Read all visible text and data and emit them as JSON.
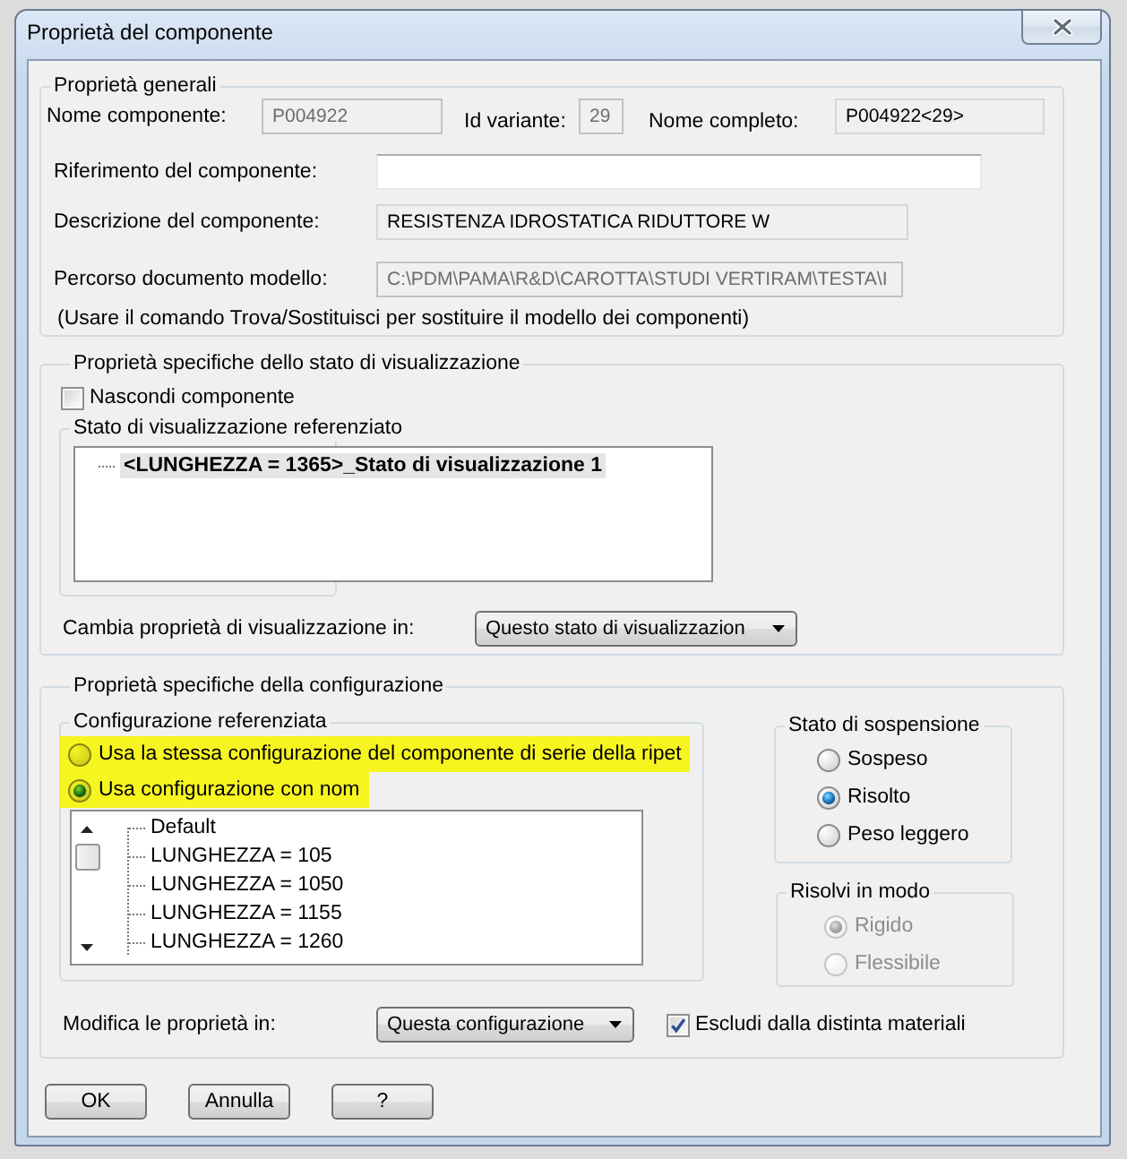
{
  "window": {
    "title": "Proprietà del componente"
  },
  "general": {
    "title": "Proprietà generali",
    "id_fields": [
      {
        "label": "Nome componente:",
        "value": "P004922",
        "disabled": true,
        "readonly": false
      },
      {
        "label": "Id variante:",
        "value": "29",
        "disabled": true,
        "readonly": false
      },
      {
        "label": "Nome completo:",
        "value": "P004922<29>",
        "disabled": false,
        "readonly": true
      }
    ],
    "fields": [
      {
        "label": "Riferimento del componente:",
        "disabled": false,
        "readonly": false
      },
      {
        "label": "Descrizione del componente:",
        "value": "RESISTENZA IDROSTATICA RIDUTTORE W",
        "disabled": false,
        "readonly": true
      },
      {
        "label": "Percorso documento modello:",
        "value": "C:\\PDM\\PAMA\\R&D\\CAROTTA\\STUDI VERTIRAM\\TESTA\\I",
        "disabled": true,
        "readonly": false
      }
    ],
    "note": "(Usare il comando Trova/Sostituisci per sostituire il modello dei componenti)"
  },
  "display_state": {
    "title": "Proprietà specifiche dello stato di visualizzazione",
    "hide_component": {
      "label": "Nascondi componente",
      "checked": false
    },
    "referenced": {
      "title": "Stato di visualizzazione referenziato",
      "items": [
        {
          "label": "<LUNGHEZZA = 1365>_Stato di visualizzazione 1",
          "selected": true
        }
      ]
    },
    "change_in": {
      "label": "Cambia proprietà di visualizzazione in:",
      "value": "Questo stato di visualizzazion"
    }
  },
  "configuration": {
    "title": "Proprietà specifiche della configurazione",
    "referenced": {
      "title": "Configurazione referenziata",
      "options": [
        {
          "label": "Usa la stessa configurazione del componente di serie della ripet",
          "selected": false,
          "highlighted": true
        },
        {
          "label": "Usa configurazione con nom",
          "selected": true,
          "highlighted": true
        }
      ],
      "configurations": [
        {
          "label": "Default",
          "selected": false
        },
        {
          "label": "LUNGHEZZA = 105",
          "selected": false
        },
        {
          "label": "LUNGHEZZA = 1050",
          "selected": false
        },
        {
          "label": "LUNGHEZZA = 1155",
          "selected": false
        },
        {
          "label": "LUNGHEZZA = 1260",
          "selected": false
        }
      ]
    },
    "suppression": {
      "title": "Stato di sospensione",
      "options": [
        {
          "label": "Sospeso",
          "selected": false
        },
        {
          "label": "Risolto",
          "selected": true
        },
        {
          "label": "Peso leggero",
          "selected": false
        }
      ]
    },
    "solve_as": {
      "title": "Risolvi in modo",
      "disabled": true,
      "options": [
        {
          "label": "Rigido",
          "selected": true
        },
        {
          "label": "Flessibile",
          "selected": false
        }
      ]
    },
    "modify_in": {
      "label": "Modifica le proprietà in:",
      "value": "Questa configurazione"
    },
    "exclude_bom": {
      "label": "Escludi dalla distinta materiali",
      "checked": true
    }
  },
  "buttons": [
    "OK",
    "Annulla",
    "?"
  ]
}
